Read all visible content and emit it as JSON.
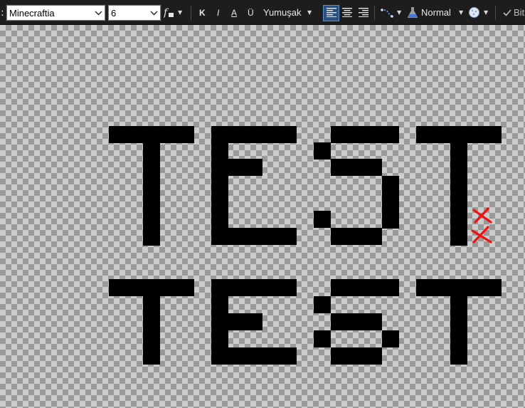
{
  "toolbar": {
    "label_suffix": ":",
    "font_name": "Minecraftia",
    "font_size": "6",
    "bold": "K",
    "italic": "I",
    "underline": "A",
    "strikethrough": "Ü",
    "antialias": "Yumuşak",
    "blend_mode": "Normal",
    "bitmap_label": "Bit"
  },
  "canvas": {
    "text_lines": [
      "TEST",
      "TEST"
    ],
    "text_color": "#000000",
    "annotation_color": "#ee1111"
  }
}
